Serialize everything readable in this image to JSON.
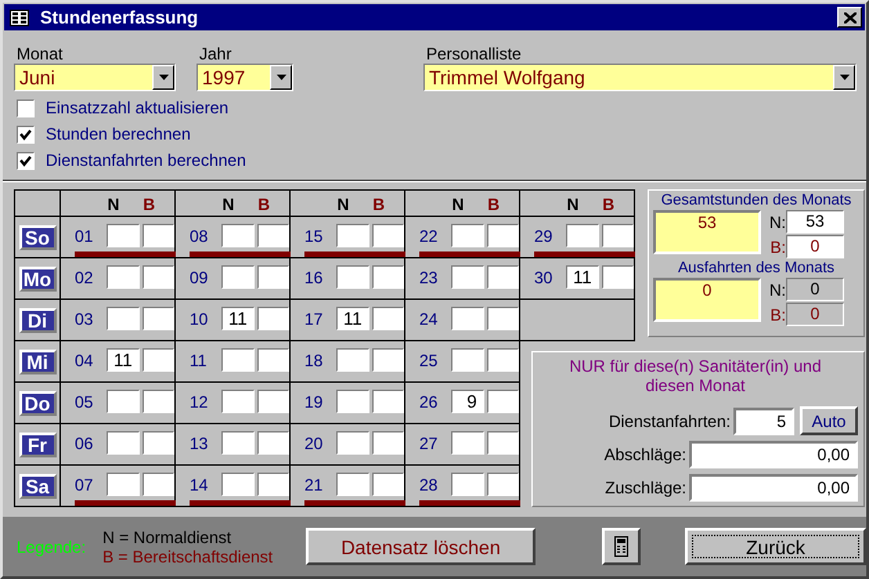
{
  "window": {
    "title": "Stundenerfassung"
  },
  "selectors": [
    {
      "label": "Monat",
      "value": "Juni"
    },
    {
      "label": "Jahr",
      "value": "1997"
    },
    {
      "label": "Personalliste",
      "value": "Trimmel Wolfgang"
    }
  ],
  "options": [
    {
      "label": "Einsatzzahl aktualisieren",
      "checked": false
    },
    {
      "label": "Stunden berechnen",
      "checked": true
    },
    {
      "label": "Dienstanfahrten berechnen",
      "checked": true
    }
  ],
  "weekdays": [
    "So",
    "Mo",
    "Di",
    "Mi",
    "Do",
    "Fr",
    "Sa"
  ],
  "weeks": [
    {
      "n_header": "N",
      "b_header": "B",
      "days": [
        {
          "date": "01",
          "weekend": true
        },
        {
          "date": "02",
          "weekend": false
        },
        {
          "date": "03",
          "weekend": false
        },
        {
          "date": "04",
          "n": "11",
          "weekend": false
        },
        {
          "date": "05",
          "weekend": false
        },
        {
          "date": "06",
          "weekend": false
        },
        {
          "date": "07",
          "weekend": true
        }
      ]
    },
    {
      "n_header": "N",
      "b_header": "B",
      "days": [
        {
          "date": "08",
          "weekend": true
        },
        {
          "date": "09",
          "weekend": false
        },
        {
          "date": "10",
          "n": "11",
          "weekend": false
        },
        {
          "date": "11",
          "weekend": false
        },
        {
          "date": "12",
          "weekend": false
        },
        {
          "date": "13",
          "weekend": false
        },
        {
          "date": "14",
          "weekend": true
        }
      ]
    },
    {
      "n_header": "N",
      "b_header": "B",
      "days": [
        {
          "date": "15",
          "weekend": true
        },
        {
          "date": "16",
          "weekend": false
        },
        {
          "date": "17",
          "n": "11",
          "weekend": false
        },
        {
          "date": "18",
          "weekend": false
        },
        {
          "date": "19",
          "weekend": false
        },
        {
          "date": "20",
          "weekend": false
        },
        {
          "date": "21",
          "weekend": true
        }
      ]
    },
    {
      "n_header": "N",
      "b_header": "B",
      "days": [
        {
          "date": "22",
          "weekend": true
        },
        {
          "date": "23",
          "weekend": false
        },
        {
          "date": "24",
          "weekend": false
        },
        {
          "date": "25",
          "weekend": false
        },
        {
          "date": "26",
          "n": "9",
          "weekend": false
        },
        {
          "date": "27",
          "weekend": false
        },
        {
          "date": "28",
          "weekend": true
        }
      ]
    },
    {
      "n_header": "N",
      "b_header": "B",
      "days": [
        {
          "date": "29",
          "weekend": true
        },
        {
          "date": "30",
          "n": "11",
          "weekend": false
        },
        {
          "kind": "blank"
        }
      ]
    }
  ],
  "totals": [
    {
      "title": "Gesamtstunden des Monats",
      "value": "53",
      "n_label": "N:",
      "n": "53",
      "b_label": "B:",
      "b": "0",
      "disabled": false
    },
    {
      "title": "Ausfahrten des Monats",
      "value": "0",
      "n_label": "N:",
      "n": "0",
      "b_label": "B:",
      "b": "0",
      "disabled": true
    }
  ],
  "adjustments": {
    "title": "NUR für diese(n) Sanitäter(in) und diesen Monat",
    "rows": [
      {
        "label": "Dienstanfahrten:",
        "value": "5",
        "button": "Auto"
      },
      {
        "label": "Abschläge:",
        "value": "0,00"
      },
      {
        "label": "Zuschläge:",
        "value": "0,00"
      }
    ]
  },
  "legend": {
    "title": "Legende:",
    "items": [
      {
        "text": "N = Normaldienst",
        "kind": "normal"
      },
      {
        "text": "B = Bereitschaftsdienst",
        "kind": "standby"
      }
    ]
  },
  "buttons": [
    {
      "kind": "text",
      "label": "Datensatz löschen",
      "focused": false
    },
    {
      "kind": "calculator",
      "focused": false
    },
    {
      "kind": "text",
      "label": "Zurück",
      "focused": true
    }
  ]
}
